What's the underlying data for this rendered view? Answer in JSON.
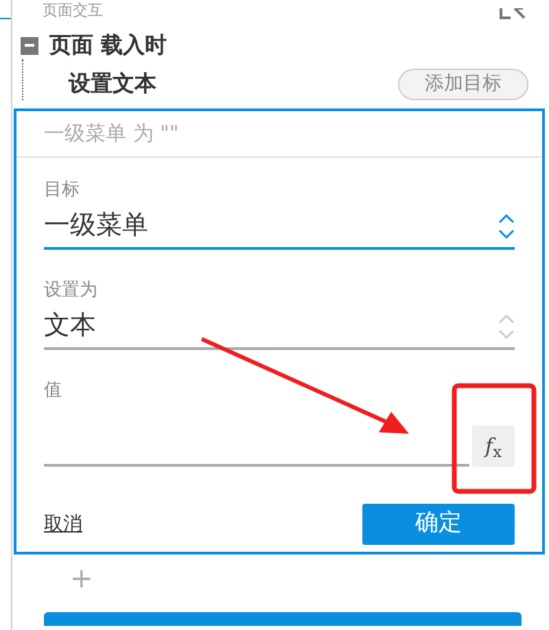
{
  "panel_title": "页面交互",
  "event": {
    "label": "页面 载入时",
    "expanded": true
  },
  "action": {
    "label": "设置文本",
    "add_target_button": "添加目标"
  },
  "editor": {
    "summary": "一级菜单 为 \"\"",
    "fields": [
      {
        "kind": "select",
        "label": "目标",
        "value": "一级菜单",
        "focused": true
      },
      {
        "kind": "select",
        "label": "设置为",
        "value": "文本",
        "focused": false
      },
      {
        "kind": "input",
        "label": "值",
        "function_button": "*f*$_{x}$"
      }
    ],
    "cancel_link": "取消",
    "confirm_button": "确定"
  },
  "add_action": "+"
}
